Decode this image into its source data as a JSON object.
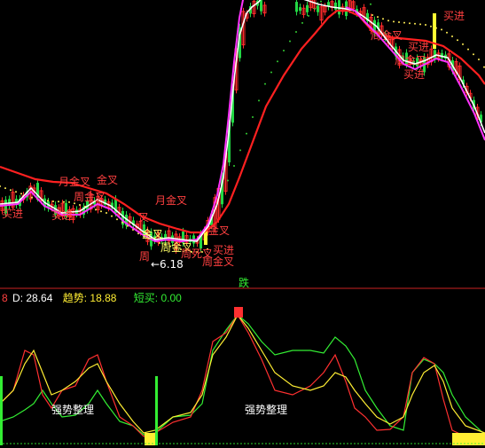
{
  "colors": {
    "background": "#000000",
    "up_candle": "#ff2b2b",
    "down_candle": "#22d844",
    "ma_white": "#ffffff",
    "ma_magenta": "#ff33ff",
    "ma_red": "#ff2020",
    "dots": "#ffee55",
    "green_dots": "#33cc33",
    "divider": "#cc2222",
    "indicator_red": "#ff3030",
    "indicator_yellow": "#ffee33",
    "indicator_green": "#33ee33",
    "signal_red_text": "#ff4040",
    "signal_yellow_text": "#ffff66",
    "label_text": "#ffffff"
  },
  "main_panel": {
    "signals": [
      {
        "id": "maijin-1",
        "text": "买进"
      },
      {
        "id": "yuejinchaA",
        "text": "月金叉"
      },
      {
        "id": "jinchaA",
        "text": "金叉"
      },
      {
        "id": "zhoujinchaA",
        "text": "周金叉"
      },
      {
        "id": "maijin-2",
        "text": "买进"
      },
      {
        "id": "chaA",
        "text": "叉"
      },
      {
        "id": "yuejinchaB",
        "text": "月金叉"
      },
      {
        "id": "jinchaB",
        "text": "金叉"
      },
      {
        "id": "zhoujinchaB",
        "text": "周金叉"
      },
      {
        "id": "zhouB",
        "text": "周"
      },
      {
        "id": "jinchaC",
        "text": "金叉"
      },
      {
        "id": "maijin-3",
        "text": "买进"
      },
      {
        "id": "sichaA",
        "text": "周死叉"
      },
      {
        "id": "maijin-4",
        "text": "买进"
      },
      {
        "id": "zhoujinchaC",
        "text": "周金叉"
      },
      {
        "id": "maijin-5",
        "text": "买进"
      },
      {
        "id": "zhoujinchaD",
        "text": "周金叉"
      },
      {
        "id": "maijin-6",
        "text": "买进"
      }
    ],
    "low_price_label": "←6.18",
    "bottom_marker": "跌"
  },
  "indicator_header": {
    "lead": "8",
    "d_label": "D: 28.64",
    "trend_label": "趋势: 18.88",
    "short_buy_label": "短买: 0.00"
  },
  "indicator_panel": {
    "zone_labels": [
      "强势整理",
      "强势整理"
    ]
  }
}
